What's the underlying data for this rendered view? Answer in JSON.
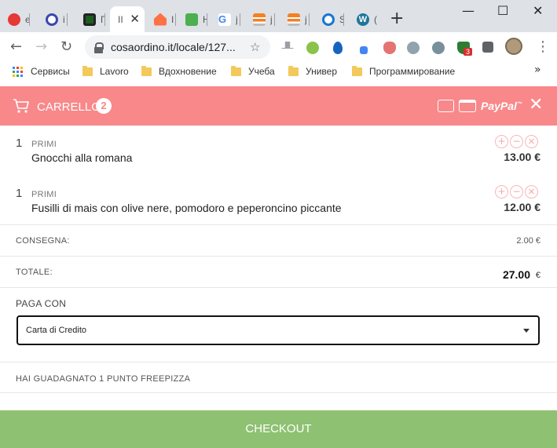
{
  "browser": {
    "tabs": [
      {
        "title": "e",
        "favicon_color": "#e53935"
      },
      {
        "title": "i",
        "favicon_color": "#3949ab"
      },
      {
        "title": "Г",
        "favicon_color": "#2e7d32"
      },
      {
        "title": "II",
        "favicon_color": "#ffffff",
        "active": true
      },
      {
        "title": "Ι",
        "favicon_color": "#ff7043"
      },
      {
        "title": "Η",
        "favicon_color": "#4caf50"
      },
      {
        "title": "j",
        "favicon_color": "#4285f4"
      },
      {
        "title": "j",
        "favicon_color": "#f48024"
      },
      {
        "title": "j",
        "favicon_color": "#f48024"
      },
      {
        "title": "S",
        "favicon_color": "#1976d2"
      },
      {
        "title": "(",
        "favicon_color": "#21759b"
      }
    ],
    "tab_close": "✕",
    "new_tab": "+",
    "window_controls": {
      "minimize": "—",
      "maximize": "☐",
      "close": "✕"
    },
    "url": "cosaordino.it/locale/127...",
    "bookmarks": [
      {
        "label": "Сервисы",
        "type": "apps"
      },
      {
        "label": "Lavoro",
        "type": "folder"
      },
      {
        "label": "Вдохновение",
        "type": "folder"
      },
      {
        "label": "Учеба",
        "type": "folder"
      },
      {
        "label": "Универ",
        "type": "folder"
      },
      {
        "label": "Программирование",
        "type": "folder"
      }
    ],
    "bookmarks_more": "»",
    "extension_badge": "3"
  },
  "cart": {
    "title": "CARRELLO",
    "count": "2",
    "paypal_label": "PayPal",
    "paypal_tm": "™",
    "close": "✕",
    "items": [
      {
        "qty": "1",
        "category": "PRIMI",
        "name": "Gnocchi alla romana",
        "price": "13.00 €"
      },
      {
        "qty": "1",
        "category": "PRIMI",
        "name": "Fusilli di mais con olive nere, pomodoro e peperoncino piccante",
        "price": "12.00 €"
      }
    ],
    "controls": {
      "add": "+",
      "remove": "−",
      "delete": "×"
    },
    "delivery_label": "CONSEGNA:",
    "delivery_value": "2.00 €",
    "total_label": "TOTALE:",
    "total_value": "27.00",
    "total_currency": "€",
    "pay_with_label": "PAGA CON",
    "payment_method": "Carta di Credito",
    "earned_text": "HAI GUADAGNATO 1 PUNTO FREEPIZZA",
    "checkout_label": "CHECKOUT"
  }
}
